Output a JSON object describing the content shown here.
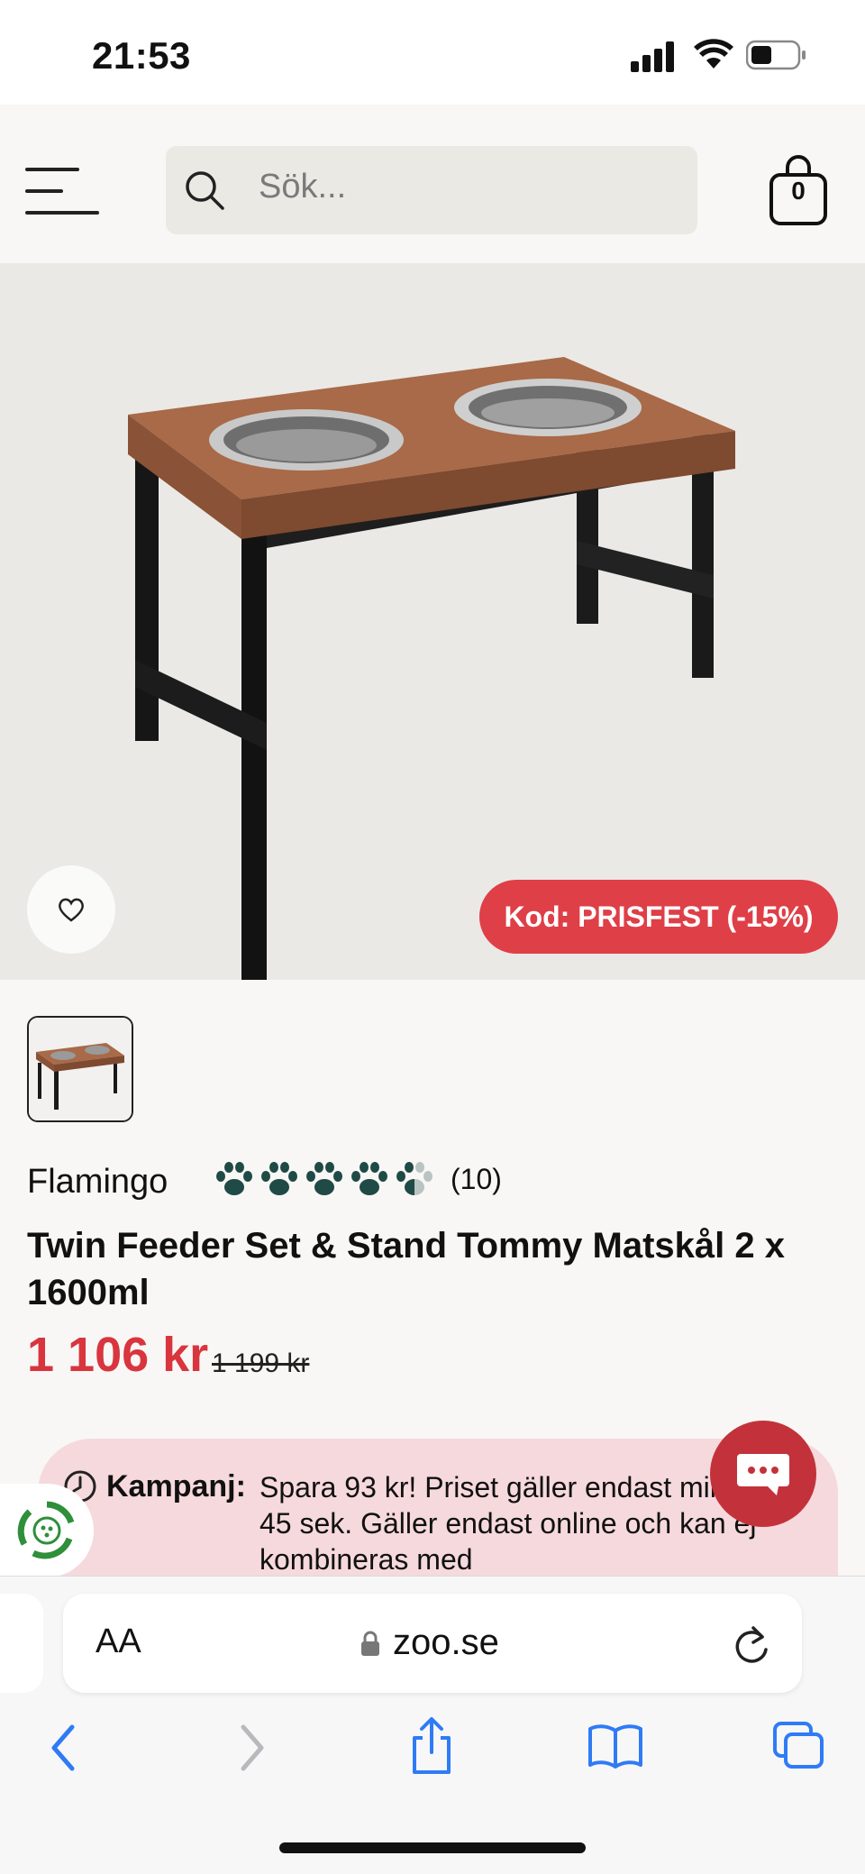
{
  "status": {
    "time": "21:53"
  },
  "header": {
    "search_placeholder": "Sök...",
    "cart_count": "0"
  },
  "product": {
    "promo_badge": "Kod: PRISFEST (-15%)",
    "brand": "Flamingo",
    "rating": 4.5,
    "rating_count": "(10)",
    "title": "Twin Feeder Set & Stand Tommy Matskål 2 x 1600ml",
    "price": "1 106 kr",
    "old_price": "1 199 kr"
  },
  "campaign": {
    "label": "Kampanj:",
    "text": "Spara 93 kr! Priset gäller endast min och 45 sek. Gäller endast online och kan ej kombineras med"
  },
  "browser": {
    "aa": "AA",
    "url": "zoo.se"
  },
  "colors": {
    "accent_red": "#df3f47",
    "price_red": "#d8353e",
    "paw_green": "#1f4a45"
  }
}
